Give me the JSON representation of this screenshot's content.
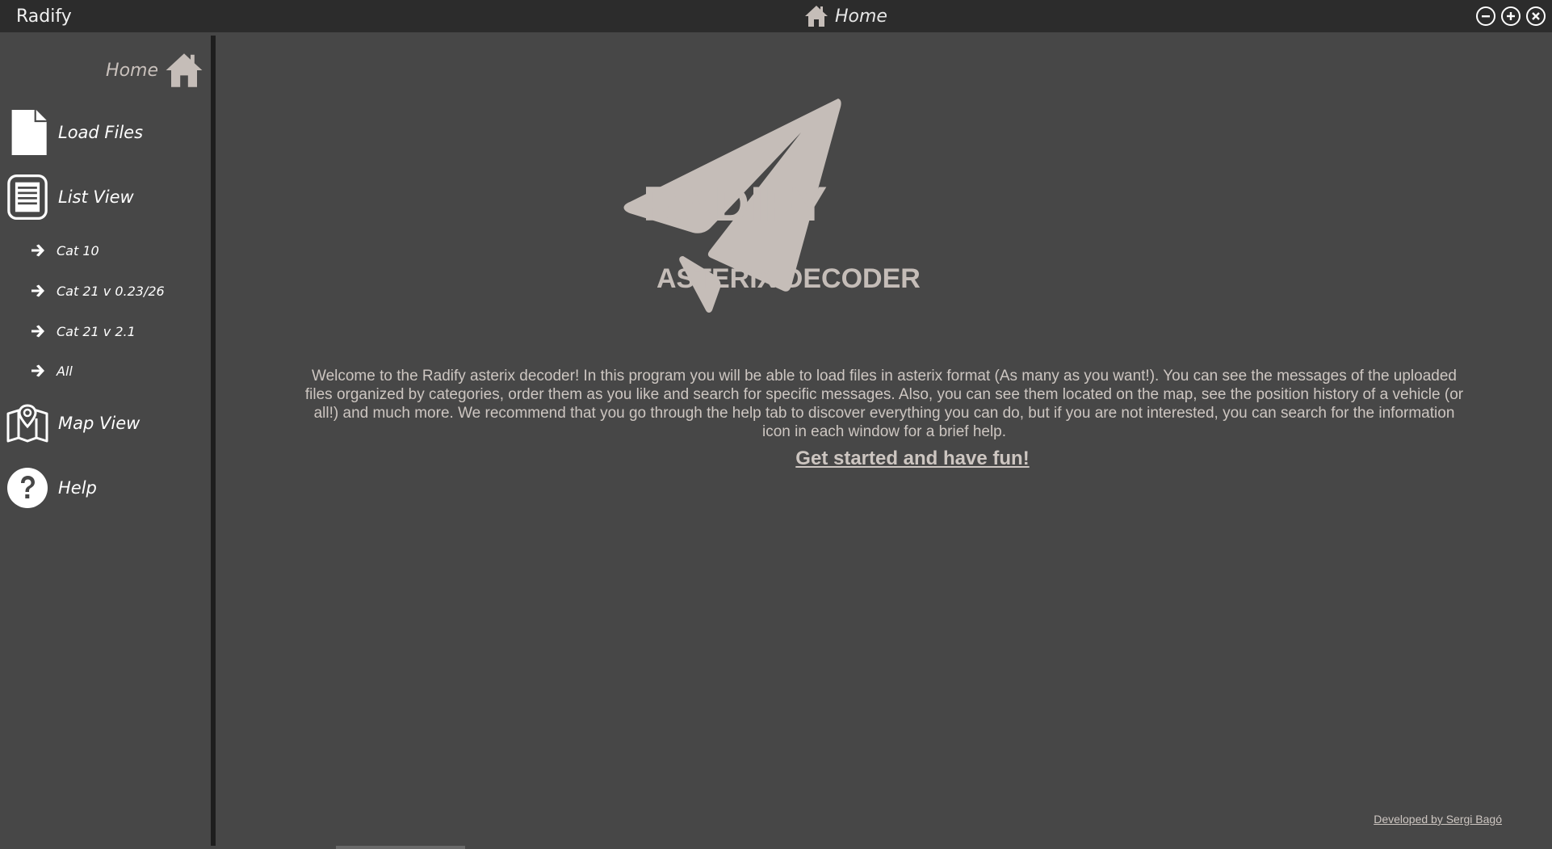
{
  "window": {
    "app_title": "Radify",
    "page_title": "Home"
  },
  "sidebar": {
    "home_label": "Home",
    "items": [
      {
        "label": "Load Files",
        "icon": "file-icon"
      },
      {
        "label": "List View",
        "icon": "list-icon"
      }
    ],
    "sub_items": [
      {
        "label": "Cat 10"
      },
      {
        "label": "Cat 21 v 0.23/26"
      },
      {
        "label": "Cat 21 v 2.1"
      },
      {
        "label": "All"
      }
    ],
    "bottom_items": [
      {
        "label": "Map View",
        "icon": "map-icon"
      },
      {
        "label": "Help",
        "icon": "help-icon"
      }
    ]
  },
  "main": {
    "brand_title": "RADIFY",
    "brand_subtitle": "ASTERIX DECODER",
    "welcome_lines": [
      "Welcome to the Radify asterix decoder! In this program you will be able to load  files in asterix  format (As many as you want!). You can see the messages  of the uploaded",
      "files organized by categories, order them as you like and  search for specific messages. Also, you can see them located on the map,  see the position history of a vehicle (or",
      "all!) and much more. We  recommend that you go through the help  tab to discover everything you  can do, but if you are not interested, you can search for the information",
      "icon  in each window for a brief help."
    ],
    "cta": "Get started and have fun!",
    "credit": "Developed by Sergi Bagó"
  },
  "colors": {
    "background": "#474747",
    "titlebar": "#2c2c2c",
    "accent": "#c5bdb8"
  }
}
